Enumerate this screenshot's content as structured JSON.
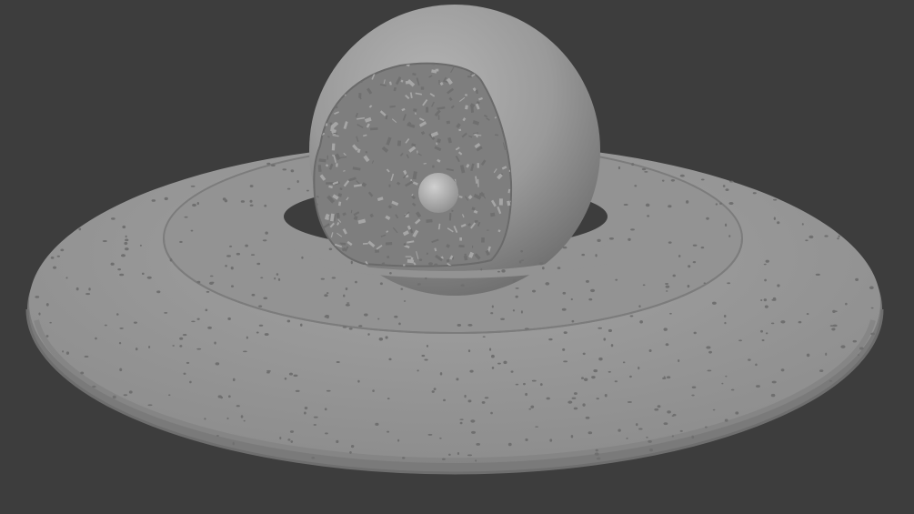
{
  "viewport": {
    "background": "#3d3d3d",
    "scene": {
      "subject": "planet-with-ring",
      "colors": {
        "ring_top": "#9a9a9a",
        "ring_edge": "#7d7d7d",
        "sphere_shell": "#8f8f8f",
        "interior_debris": "#a6a6a6",
        "core": "#b5b5b5",
        "pebbles": "#6f6f6f"
      }
    }
  }
}
